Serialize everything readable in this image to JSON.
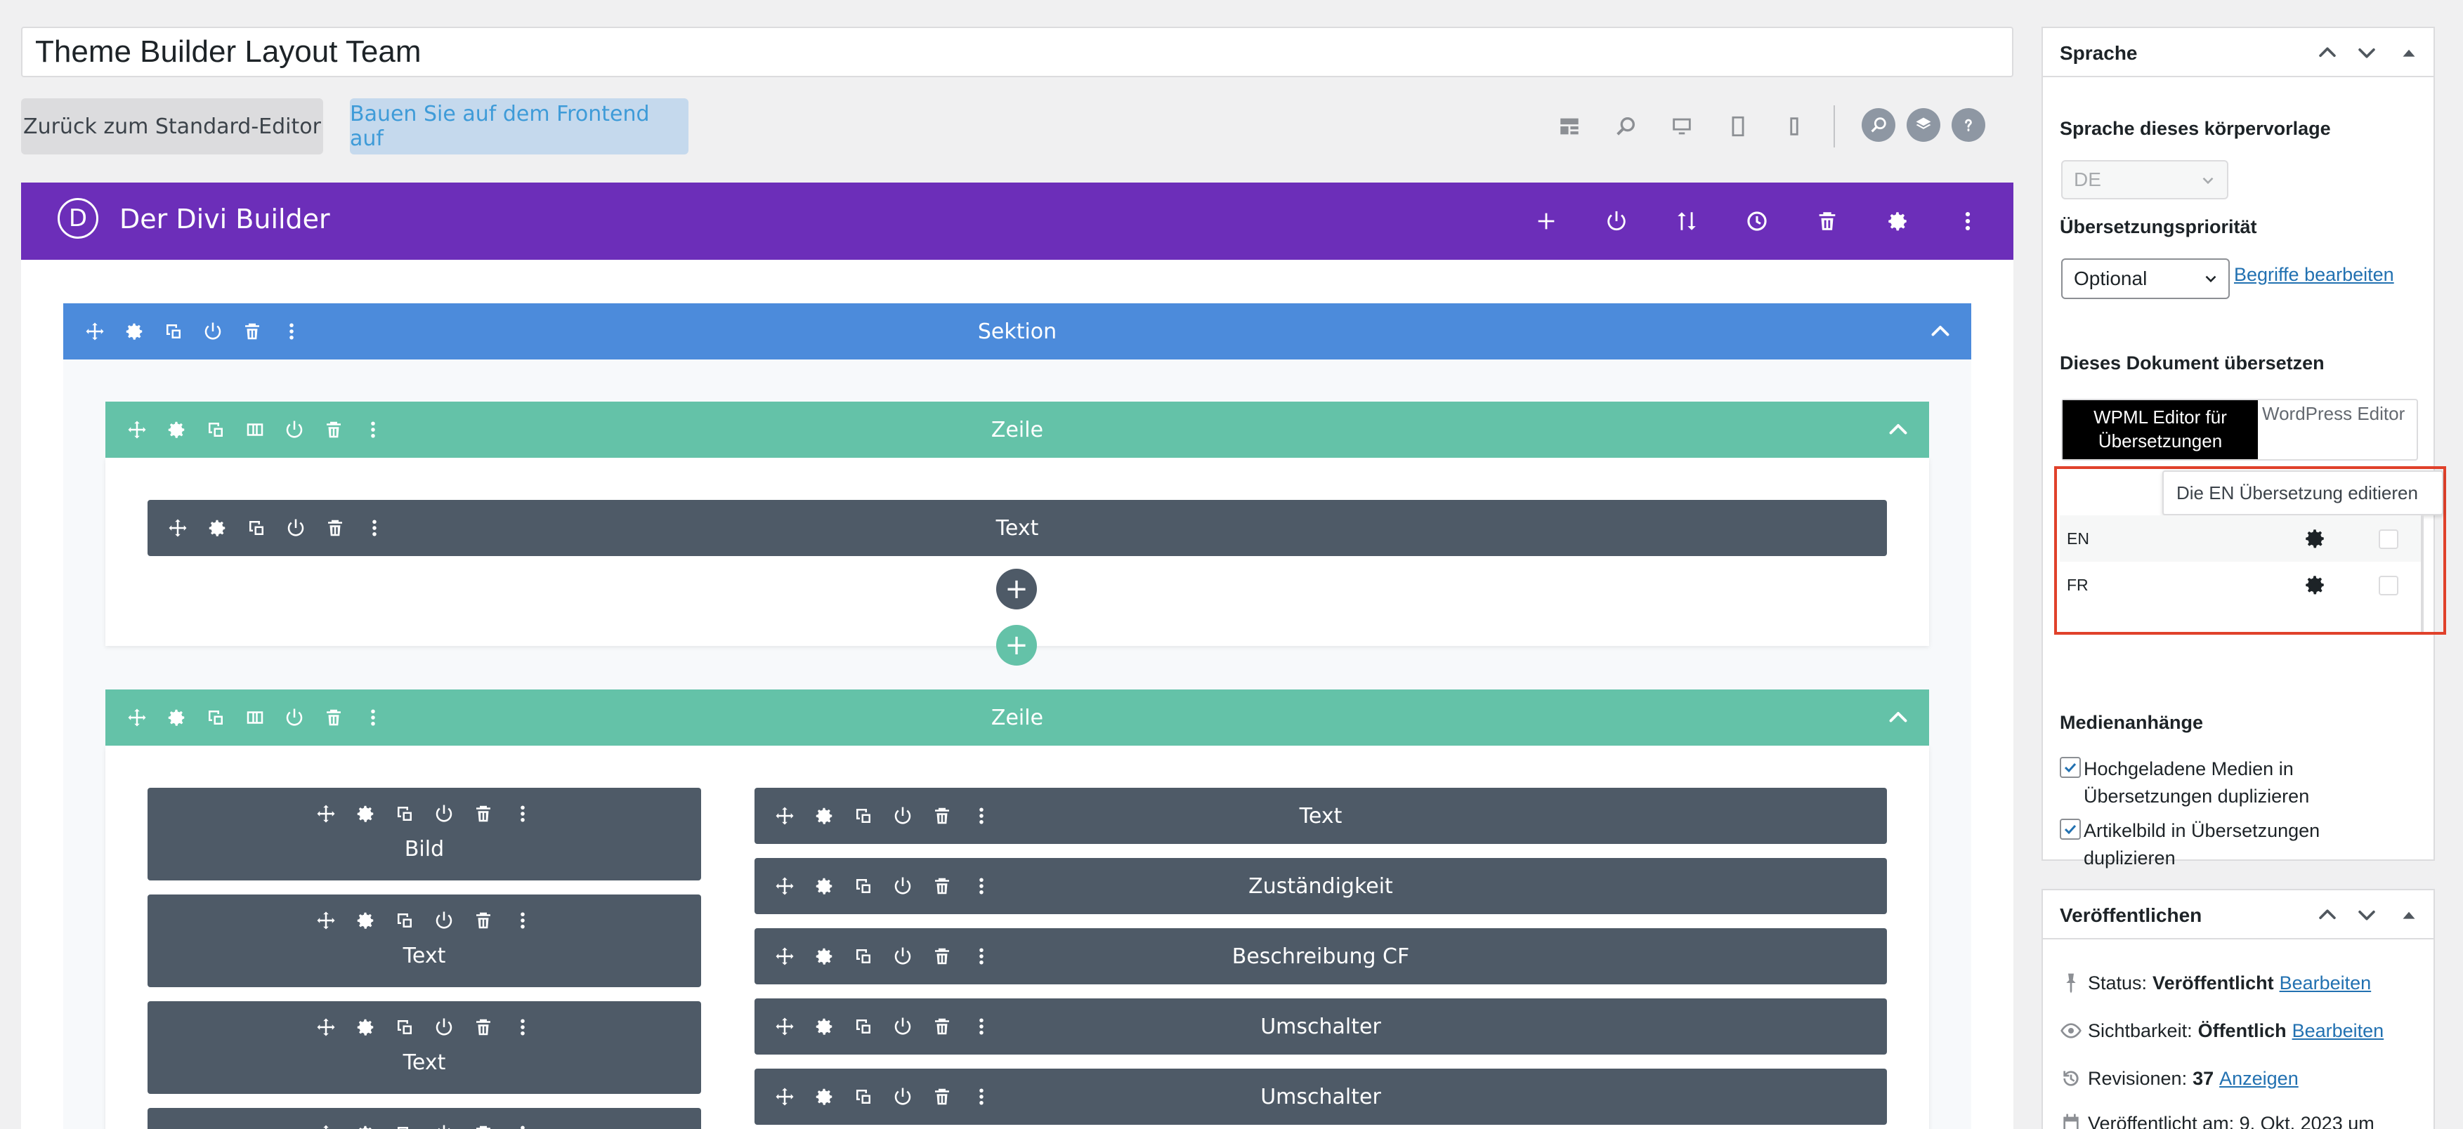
{
  "title_value": "Theme Builder Layout Team",
  "buttons": {
    "back": "Zurück zum Standard-Editor",
    "frontend": "Bauen Sie auf dem Frontend auf"
  },
  "divi": {
    "logo": "D",
    "title": "Der Divi Builder"
  },
  "builder": {
    "section_label": "Sektion",
    "row1_label": "Zeile",
    "row1_module": "Text",
    "row2_label": "Zeile",
    "left_modules": [
      "Bild",
      "Text",
      "Text"
    ],
    "right_modules": [
      "Text",
      "Zuständigkeit",
      "Beschreibung CF",
      "Umschalter",
      "Umschalter"
    ],
    "add_symbol": "+"
  },
  "sidebar": {
    "language": {
      "title": "Sprache",
      "lang_label": "Sprache dieses körpervorlage",
      "lang_value": "DE",
      "priority_label": "Übersetzungspriorität",
      "priority_value": "Optional",
      "terms_link": "Begriffe bearbeiten",
      "translate_label": "Dieses Dokument übersetzen",
      "tab_wpml": "WPML Editor für Übersetzungen",
      "tab_wp": "WordPress Editor",
      "tooltip": "Die EN Übersetzung editieren",
      "translations": [
        {
          "code": "EN"
        },
        {
          "code": "FR"
        }
      ],
      "media_label": "Medienanhänge",
      "checkbox1": "Hochgeladene Medien in Übersetzungen duplizieren",
      "checkbox2": "Artikelbild in Übersetzungen duplizieren"
    },
    "publish": {
      "title": "Veröffentlichen",
      "status_label": "Status:",
      "status_value": "Veröffentlicht",
      "status_link": "Bearbeiten",
      "visibility_label": "Sichtbarkeit:",
      "visibility_value": "Öffentlich",
      "visibility_link": "Bearbeiten",
      "revisions_label": "Revisionen:",
      "revisions_value": "37",
      "revisions_link": "Anzeigen",
      "published_text": "Veröffentlicht am: 9. Okt. 2023 um"
    }
  },
  "colors": {
    "divi_purple": "#6c2eb9",
    "section_blue": "#4c8bdb",
    "row_green": "#64c2a8",
    "module_gray": "#4e5a67",
    "highlight_red": "#e0412b"
  }
}
